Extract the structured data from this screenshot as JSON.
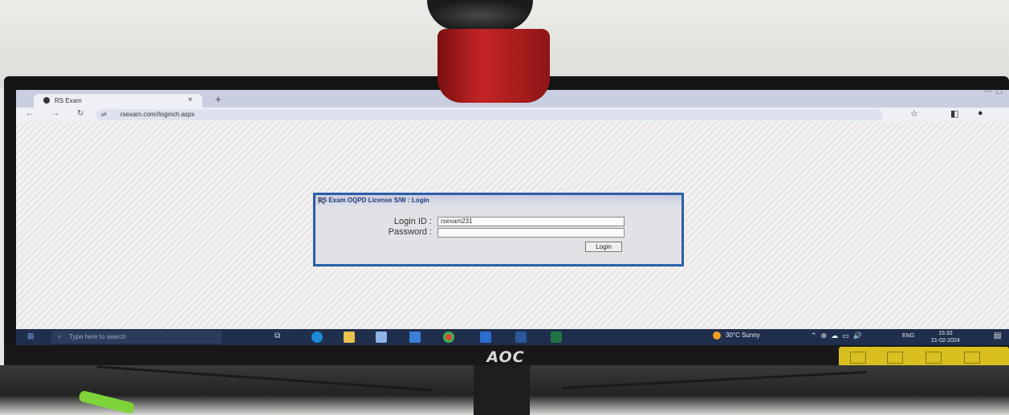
{
  "browser": {
    "tab_title": "RS Exam",
    "tab_close": "×",
    "new_tab": "+",
    "url": "rsexam.com//loginch.aspx"
  },
  "dialog": {
    "title": "RS Exam OQPD License S/W : Login",
    "login_id_label": "Login ID :",
    "login_id_value": "rsexam231",
    "password_label": "Password :",
    "password_value": "",
    "login_button": "Login"
  },
  "taskbar": {
    "search_placeholder": "Type here to search",
    "weather": "30°C  Sunny",
    "language": "ENG",
    "time": "15:33",
    "date": "21-02-2024"
  },
  "monitor": {
    "brand": "AOC"
  },
  "colors": {
    "dialog_border": "#2a5fa8",
    "taskbar": "#1f2f4d",
    "webcam": "#c42525"
  }
}
